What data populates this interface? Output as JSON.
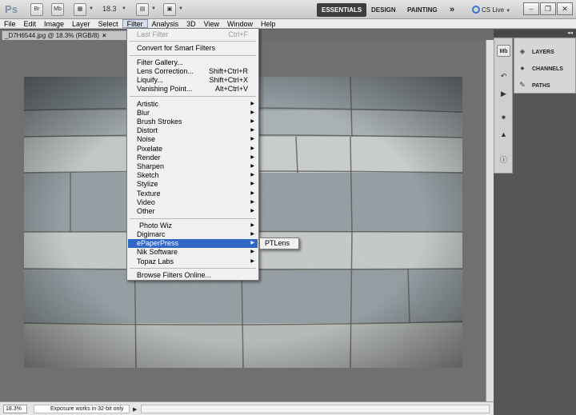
{
  "appbar": {
    "logo": "Ps",
    "bridge_label": "Br",
    "minibridge_label": "Mb",
    "zoom_value": "18.3",
    "workspaces": [
      "ESSENTIALS",
      "DESIGN",
      "PAINTING"
    ],
    "more": "»",
    "cs_live": "CS Live"
  },
  "menubar": {
    "items": [
      "File",
      "Edit",
      "Image",
      "Layer",
      "Select",
      "Filter",
      "Analysis",
      "3D",
      "View",
      "Window",
      "Help"
    ]
  },
  "document_tab": {
    "title": "_D7H6544.jpg @ 18.3% (RGB/8)",
    "close": "×"
  },
  "filter_menu": {
    "last_filter": "Last Filter",
    "last_filter_shortcut": "Ctrl+F",
    "convert": "Convert for Smart Filters",
    "filter_gallery": "Filter Gallery...",
    "lens_correction": "Lens Correction...",
    "lens_correction_shortcut": "Shift+Ctrl+R",
    "liquify": "Liquify...",
    "liquify_shortcut": "Shift+Ctrl+X",
    "vanishing_point": "Vanishing Point...",
    "vanishing_point_shortcut": "Alt+Ctrl+V",
    "groups": [
      "Artistic",
      "Blur",
      "Brush Strokes",
      "Distort",
      "Noise",
      "Pixelate",
      "Render",
      "Sharpen",
      "Sketch",
      "Stylize",
      "Texture",
      "Video",
      "Other"
    ],
    "plugins": [
      "Photo Wiz",
      "Digimarc",
      "ePaperPress",
      "Nik Software",
      "Topaz Labs"
    ],
    "browse": "Browse Filters Online..."
  },
  "submenu": {
    "item": "PTLens"
  },
  "panels": {
    "layers": "LAYERS",
    "channels": "CHANNELS",
    "paths": "PATHS"
  },
  "statusbar": {
    "zoom": "18.3%",
    "message": "Exposure works in 32-bit only"
  }
}
